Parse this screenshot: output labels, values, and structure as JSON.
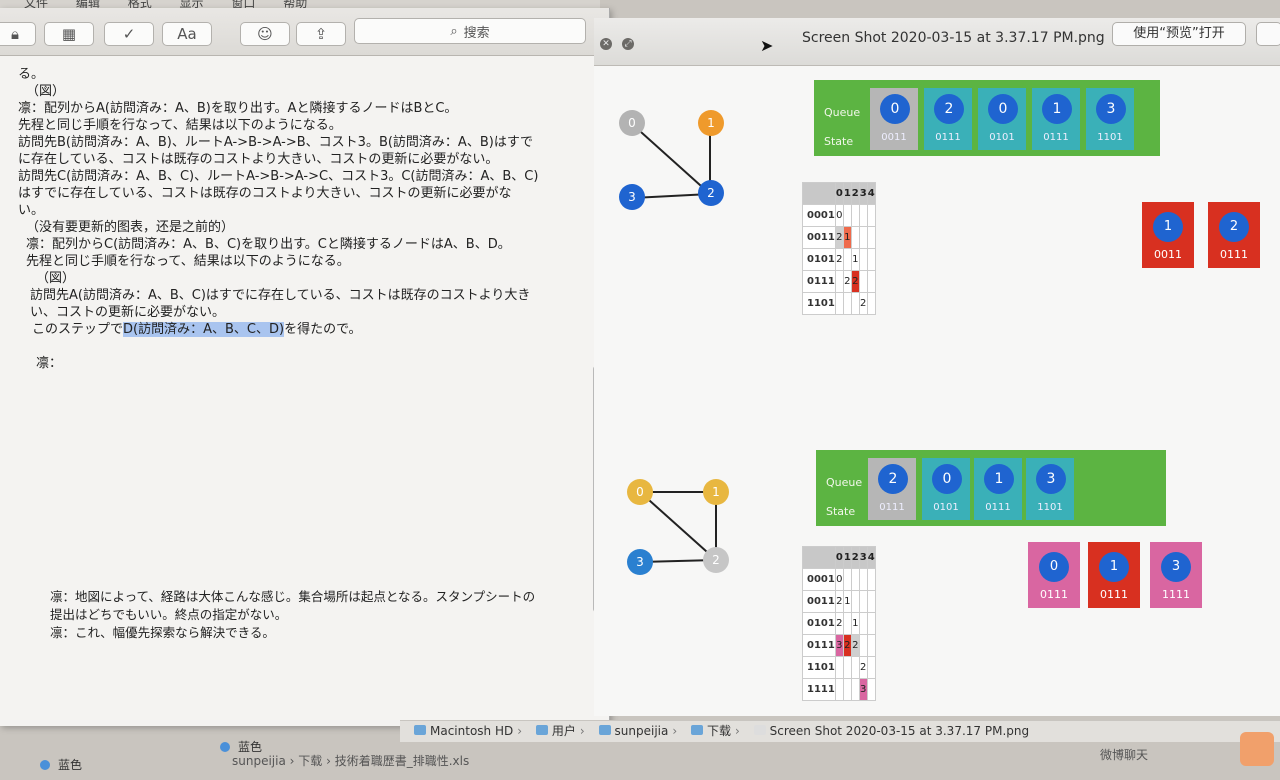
{
  "menubar": {
    "items": [
      "文件",
      "编辑",
      "格式",
      "显示",
      "窗口",
      "帮助"
    ]
  },
  "editor": {
    "search_label": "搜索",
    "font_button": "Aa",
    "lines": [
      "る。",
      "（図）",
      "凛：配列からA(訪問済み：A、B)を取り出す。Aと隣接するノードはBとC。",
      "先程と同じ手順を行なって、結果は以下のようになる。",
      "訪問先B(訪問済み：A、B)、ルートA->B->A->B、コスト3。B(訪問済み：A、B)はすで",
      "に存在している、コストは既存のコストより大きい、コストの更新に必要がない。",
      "訪問先C(訪問済み：A、B、C)、ルートA->B->A->C、コスト3。C(訪問済み：A、B、C)",
      "はすでに存在している、コストは既存のコストより大きい、コストの更新に必要がな",
      "い。",
      "（没有要更新的图表，还是之前的）",
      "凛：配列からC(訪問済み：A、B、C)を取り出す。Cと隣接するノードはA、B、D。",
      "先程と同じ手順を行なって、結果は以下のようになる。",
      "（図）",
      "訪問先A(訪問済み：A、B、C)はすでに存在している、コストは既存のコストより大き",
      "い、コストの更新に必要がない。"
    ],
    "last_line_pre": "このステップで",
    "last_line_sel": "D(訪問済み：A、B、C、D)",
    "last_line_post": "を得たので。",
    "speaker_line": "凛：",
    "note_lines": [
      "凛：地図によって、経路は大体こんな感じ。集合場所は起点となる。スタンプシートの",
      "提出はどちでもいい。終点の指定がない。",
      "凛：これ、幅優先探索なら解決できる。"
    ]
  },
  "preview": {
    "title": "Screen Shot 2020-03-15 at 3.37.17 PM.png",
    "open_button": "使用“预览”打开",
    "queue_label": "Queue",
    "state_label": "State",
    "top": {
      "nodes": [
        "0",
        "1",
        "2",
        "3"
      ],
      "queue": [
        {
          "id": "0",
          "state": "0011",
          "grey": true
        },
        {
          "id": "2",
          "state": "0111",
          "grey": false
        },
        {
          "id": "0",
          "state": "0101",
          "grey": false
        },
        {
          "id": "1",
          "state": "0111",
          "grey": false
        },
        {
          "id": "3",
          "state": "1101",
          "grey": false
        }
      ],
      "table_cols": [
        "0",
        "1",
        "2",
        "3",
        "4"
      ],
      "table_rows": [
        {
          "label": "0001",
          "cells": [
            "0",
            "",
            "",
            "",
            ""
          ]
        },
        {
          "label": "0011",
          "cells": [
            "2",
            "1",
            "",
            "",
            ""
          ]
        },
        {
          "label": "0101",
          "cells": [
            "2",
            "",
            "1",
            "",
            ""
          ]
        },
        {
          "label": "0111",
          "cells": [
            "",
            "2",
            "2",
            "",
            ""
          ]
        },
        {
          "label": "1101",
          "cells": [
            "",
            "",
            "",
            "2",
            ""
          ]
        }
      ],
      "cards": [
        {
          "id": "1",
          "state": "0011"
        },
        {
          "id": "2",
          "state": "0111"
        }
      ]
    },
    "bottom": {
      "nodes": [
        "0",
        "1",
        "2",
        "3"
      ],
      "queue": [
        {
          "id": "2",
          "state": "0111",
          "grey": true
        },
        {
          "id": "0",
          "state": "0101",
          "grey": false
        },
        {
          "id": "1",
          "state": "0111",
          "grey": false
        },
        {
          "id": "3",
          "state": "1101",
          "grey": false
        }
      ],
      "table_cols": [
        "0",
        "1",
        "2",
        "3",
        "4"
      ],
      "table_rows": [
        {
          "label": "0001",
          "cells": [
            "0",
            "",
            "",
            "",
            ""
          ]
        },
        {
          "label": "0011",
          "cells": [
            "2",
            "1",
            "",
            "",
            ""
          ]
        },
        {
          "label": "0101",
          "cells": [
            "2",
            "",
            "1",
            "",
            ""
          ]
        },
        {
          "label": "0111",
          "cells": [
            "3",
            "2",
            "2",
            "",
            ""
          ]
        },
        {
          "label": "1101",
          "cells": [
            "",
            "",
            "",
            "2",
            ""
          ]
        },
        {
          "label": "1111",
          "cells": [
            "",
            "",
            "",
            "3",
            ""
          ]
        }
      ],
      "cards": [
        {
          "id": "0",
          "state": "0111"
        },
        {
          "id": "1",
          "state": "0111"
        },
        {
          "id": "3",
          "state": "1111"
        }
      ]
    }
  },
  "pathbar": {
    "items": [
      "Macintosh HD",
      "用户",
      "sunpeijia",
      "下载",
      "Screen Shot 2020-03-15 at 3.37.17 PM.png"
    ]
  },
  "bottom_bar": {
    "label_1": "蓝色",
    "label_2": "蓝色",
    "user": "sunpeijia",
    "folder": "下载",
    "file": "技術着職歴書_排職性.xls",
    "chat": "微博聊天"
  },
  "colors": {
    "queue_green": "#5cb442",
    "queue_cell": "#3ab0b8",
    "node_blue": "#1f64d0",
    "selection": "#a9c4ef"
  }
}
